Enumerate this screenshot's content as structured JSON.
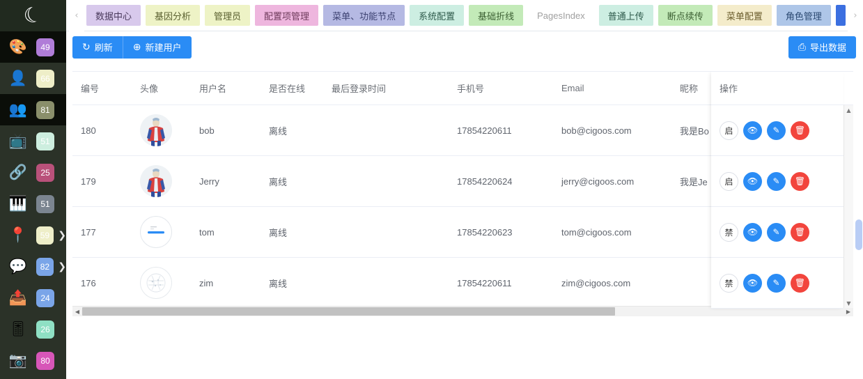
{
  "sidebar": {
    "logo_glyph": "☾",
    "logo_name": "app-logo",
    "items": [
      {
        "icon": "palette-icon",
        "glyph": "🎨",
        "badge": "49",
        "badge_color": "#b07dd8",
        "dark": true,
        "arrow": false
      },
      {
        "icon": "user-icon",
        "glyph": "👤",
        "badge": "66",
        "badge_color": "#eeeec8",
        "dark": false,
        "arrow": false
      },
      {
        "icon": "group-icon",
        "glyph": "👥",
        "badge": "81",
        "badge_color": "#8a8f6b",
        "dark": true,
        "arrow": false
      },
      {
        "icon": "video-icon",
        "glyph": "📺",
        "badge": "51",
        "badge_color": "#cdeedf",
        "dark": false,
        "arrow": false
      },
      {
        "icon": "link-icon",
        "glyph": "🔗",
        "badge": "25",
        "badge_color": "#b9517a",
        "dark": false,
        "arrow": false
      },
      {
        "icon": "keyboard-icon",
        "glyph": "🎹",
        "badge": "51",
        "badge_color": "#7b8590",
        "dark": false,
        "arrow": false
      },
      {
        "icon": "location-icon",
        "glyph": "📍",
        "badge": "59",
        "badge_color": "#eeeec8",
        "dark": false,
        "arrow": true
      },
      {
        "icon": "chat-icon",
        "glyph": "💬",
        "badge": "82",
        "badge_color": "#7aa5e8",
        "dark": false,
        "arrow": true
      },
      {
        "icon": "upload-icon",
        "glyph": "📤",
        "badge": "24",
        "badge_color": "#7aa5e8",
        "dark": false,
        "arrow": false
      },
      {
        "icon": "sliders-icon",
        "glyph": "🎚",
        "badge": "26",
        "badge_color": "#8fe0c4",
        "dark": false,
        "arrow": false
      },
      {
        "icon": "camera-icon",
        "glyph": "📷",
        "badge": "80",
        "badge_color": "#d756b8",
        "dark": false,
        "arrow": false
      }
    ]
  },
  "tabstrip": {
    "prev_arrow": "‹",
    "next_arrow": "›",
    "tabs": [
      {
        "label": "数据中心",
        "bg": "#d8c9ec",
        "color": "#4a3a5c",
        "style": "chip"
      },
      {
        "label": "基因分析",
        "bg": "#eef3c6",
        "color": "#5a6030",
        "style": "chip"
      },
      {
        "label": "管理员",
        "bg": "#eef3c6",
        "color": "#5a6030",
        "style": "chip"
      },
      {
        "label": "配置项管理",
        "bg": "#eeb6de",
        "color": "#6d3a5a",
        "style": "chip"
      },
      {
        "label": "菜单、功能节点",
        "bg": "#b5b9e3",
        "color": "#3c4170",
        "style": "chip"
      },
      {
        "label": "系统配置",
        "bg": "#cdeee2",
        "color": "#2f5b4c",
        "style": "chip"
      },
      {
        "label": "基础折线",
        "bg": "#c3eab8",
        "color": "#3b5f32",
        "style": "chip"
      },
      {
        "label": "PagesIndex",
        "bg": "#ffffff",
        "color": "#a0a0a0",
        "style": "plain"
      },
      {
        "label": "普通上传",
        "bg": "#cdeee2",
        "color": "#2f5b4c",
        "style": "chip"
      },
      {
        "label": "断点续传",
        "bg": "#c3eab8",
        "color": "#3b5f32",
        "style": "chip"
      },
      {
        "label": "菜单配置",
        "bg": "#f4eccb",
        "color": "#6a5c2c",
        "style": "chip"
      },
      {
        "label": "角色管理",
        "bg": "#aec6e8",
        "color": "#2c4a72",
        "style": "chip"
      },
      {
        "label": "",
        "bg": "#3b6fe0",
        "color": "#ffffff",
        "style": "active"
      }
    ]
  },
  "toolbar": {
    "refresh_label": "刷新",
    "refresh_icon": "↻",
    "new_user_label": "新建用户",
    "new_user_icon": "⊕",
    "export_label": "导出数据",
    "export_icon": "⎙",
    "accent_color": "#2a8cf5"
  },
  "table": {
    "columns": [
      {
        "key": "id",
        "label": "编号"
      },
      {
        "key": "avatar",
        "label": "头像"
      },
      {
        "key": "name",
        "label": "用户名"
      },
      {
        "key": "online",
        "label": "是否在线"
      },
      {
        "key": "last",
        "label": "最后登录时间"
      },
      {
        "key": "phone",
        "label": "手机号"
      },
      {
        "key": "email",
        "label": "Email"
      },
      {
        "key": "nick",
        "label": "昵称"
      }
    ],
    "action_column_label": "操作",
    "rows": [
      {
        "id": "180",
        "name": "bob",
        "online": "离线",
        "last": "",
        "phone": "17854220611",
        "email": "bob@cigoos.com",
        "nick": "我是Bo",
        "avatar_type": "hero",
        "toggle_label": "启"
      },
      {
        "id": "179",
        "name": "Jerry",
        "online": "离线",
        "last": "",
        "phone": "17854220624",
        "email": "jerry@cigoos.com",
        "nick": "我是Je",
        "avatar_type": "hero",
        "toggle_label": "启"
      },
      {
        "id": "177",
        "name": "tom",
        "online": "离线",
        "last": "",
        "phone": "17854220623",
        "email": "tom@cigoos.com",
        "nick": "",
        "avatar_type": "line",
        "toggle_label": "禁"
      },
      {
        "id": "176",
        "name": "zim",
        "online": "离线",
        "last": "",
        "phone": "17854220611",
        "email": "zim@cigoos.com",
        "nick": "",
        "avatar_type": "sketch",
        "toggle_label": "禁"
      }
    ],
    "action_icons": {
      "view": "👁",
      "edit": "✎",
      "delete": "🗑",
      "view_color": "#2a8cf5",
      "edit_color": "#2a8cf5",
      "delete_color": "#f2453d"
    }
  },
  "scroll": {
    "up_arrow": "▲",
    "down_arrow": "▼",
    "left_arrow": "◀",
    "right_arrow": "▶"
  }
}
